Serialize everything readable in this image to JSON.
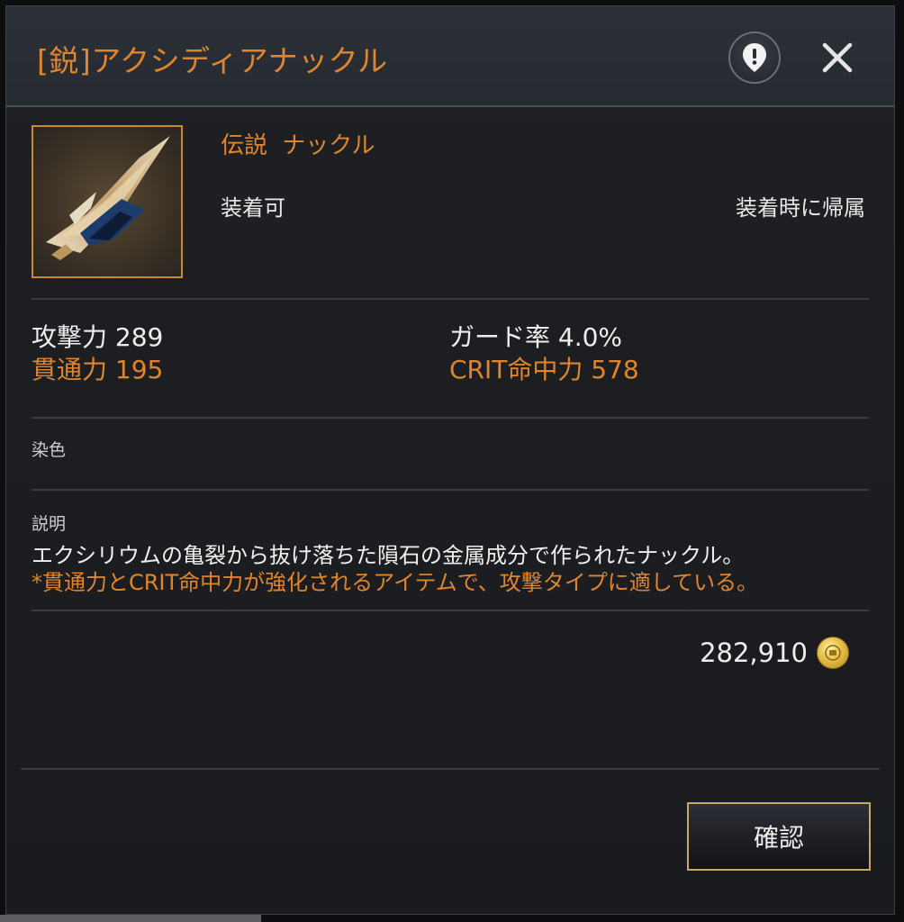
{
  "dialog": {
    "title": "[鋭]アクシディアナックル"
  },
  "item": {
    "grade_type": "伝説 ナックル",
    "equippable": "装着可",
    "bind_info": "装着時に帰属"
  },
  "stats": {
    "attack": "攻撃力 289",
    "guard_rate": "ガード率 4.0%",
    "penetration": "貫通力 195",
    "crit_hit": "CRIT命中力 578"
  },
  "dye": {
    "label": "染色"
  },
  "description": {
    "label": "説明",
    "line1": "エクシリウムの亀裂から抜け落ちた隕石の金属成分で作られたナックル。",
    "line2": "*貫通力とCRIT命中力が強化されるアイテムで、攻撃タイプに適している。"
  },
  "price": {
    "value": "282,910",
    "currency_icon": "gold-coin-icon"
  },
  "buttons": {
    "confirm_label": "確認",
    "guide_icon": "map-pin-icon",
    "close_icon": "close-icon"
  },
  "colors": {
    "accent_orange": "#e0852e",
    "button_border": "#c9a865"
  }
}
